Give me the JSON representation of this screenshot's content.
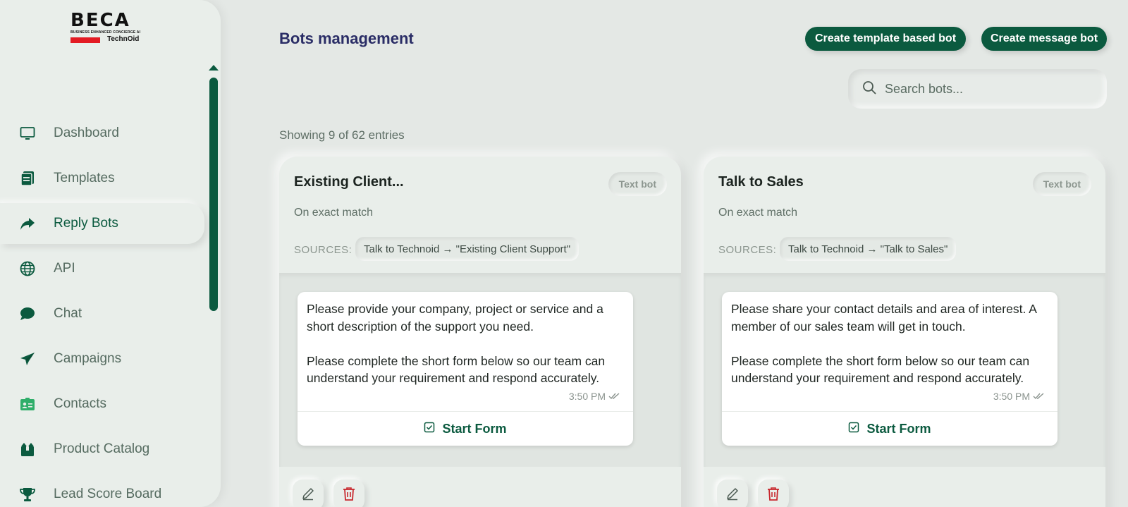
{
  "brand": {
    "logo_word": "BECA",
    "logo_sub": "BUSINESS ENHANCED CONCIERGE AI",
    "logo_tech": "TechnOid"
  },
  "colors": {
    "accent": "#0b5a3f",
    "title": "#2a2d66",
    "danger": "#c8282e"
  },
  "sidebar": {
    "items": [
      {
        "label": "Dashboard",
        "icon": "monitor-icon",
        "active": false
      },
      {
        "label": "Templates",
        "icon": "document-icon",
        "active": false
      },
      {
        "label": "Reply Bots",
        "icon": "reply-arrow-icon",
        "active": true
      },
      {
        "label": "API",
        "icon": "globe-icon",
        "active": false
      },
      {
        "label": "Chat",
        "icon": "chat-bubble-icon",
        "active": false
      },
      {
        "label": "Campaigns",
        "icon": "paper-plane-icon",
        "active": false
      },
      {
        "label": "Contacts",
        "icon": "id-card-icon",
        "active": false
      },
      {
        "label": "Product Catalog",
        "icon": "box-icon",
        "active": false
      },
      {
        "label": "Lead Score Board",
        "icon": "trophy-icon",
        "active": false
      }
    ]
  },
  "header": {
    "title": "Bots management",
    "create_template_label": "Create template based bot",
    "create_message_label": "Create message bot"
  },
  "search": {
    "placeholder": "Search bots...",
    "value": ""
  },
  "entries_text": "Showing 9 of 62 entries",
  "cards": [
    {
      "title": "Existing Client...",
      "badge": "Text bot",
      "match": "On exact match",
      "sources_label": "SOURCES:",
      "source": "Talk to Technoid → \"Existing Client Support\"",
      "message": "Please provide your company, project or service and a short description of the support you need.\n\nPlease complete the short form below so our team can understand your requirement and respond accurately.",
      "time": "3:50 PM",
      "action_label": "Start Form"
    },
    {
      "title": "Talk to Sales",
      "badge": "Text bot",
      "match": "On exact match",
      "sources_label": "SOURCES:",
      "source": "Talk to Technoid → \"Talk to Sales\"",
      "message": "Please share your contact details and area of interest. A member of our sales team will get in touch.\n\nPlease complete the short form below so our team can understand your requirement and respond accurately.",
      "time": "3:50 PM",
      "action_label": "Start Form"
    }
  ]
}
